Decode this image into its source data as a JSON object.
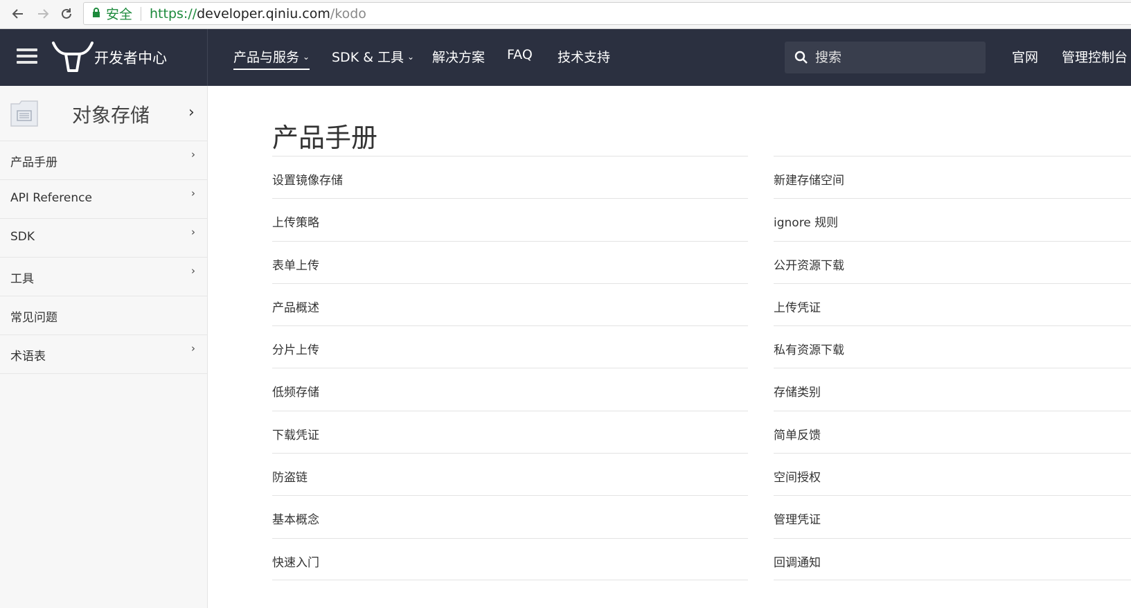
{
  "browser": {
    "secure_label": "安全",
    "url_scheme": "https://",
    "url_host": "developer.qiniu.com",
    "url_path": "/kodo"
  },
  "header": {
    "brand": "开发者中心",
    "nav": [
      {
        "label": "产品与服务",
        "has_dropdown": true,
        "active": true
      },
      {
        "label": "SDK & 工具",
        "has_dropdown": true,
        "active": false
      },
      {
        "label": "解决方案",
        "has_dropdown": false,
        "active": false
      },
      {
        "label": "FAQ",
        "has_dropdown": false,
        "active": false
      },
      {
        "label": "技术支持",
        "has_dropdown": false,
        "active": false
      }
    ],
    "search_placeholder": "搜索",
    "links": [
      "官网",
      "管理控制台"
    ]
  },
  "sidebar": {
    "product_title": "对象存储",
    "items": [
      {
        "label": "产品手册",
        "has_arrow": true
      },
      {
        "label": "API Reference",
        "has_arrow": true
      },
      {
        "label": "SDK",
        "has_arrow": true
      },
      {
        "label": "工具",
        "has_arrow": true
      },
      {
        "label": "常见问题",
        "has_arrow": false
      },
      {
        "label": "术语表",
        "has_arrow": true
      }
    ]
  },
  "main": {
    "title": "产品手册",
    "left_links": [
      "设置镜像存储",
      "上传策略",
      "表单上传",
      "产品概述",
      "分片上传",
      "低频存储",
      "下载凭证",
      "防盗链",
      "基本概念",
      "快速入门"
    ],
    "right_links": [
      "新建存储空间",
      "ignore 规则",
      "公开资源下载",
      "上传凭证",
      "私有资源下载",
      "存储类别",
      "简单反馈",
      "空间授权",
      "管理凭证",
      "回调通知"
    ]
  },
  "colors": {
    "header_bg": "#2b3040",
    "search_bg": "#393e4d",
    "sidebar_bg": "#f7f7f7",
    "secure_green": "#1d8a3c"
  }
}
